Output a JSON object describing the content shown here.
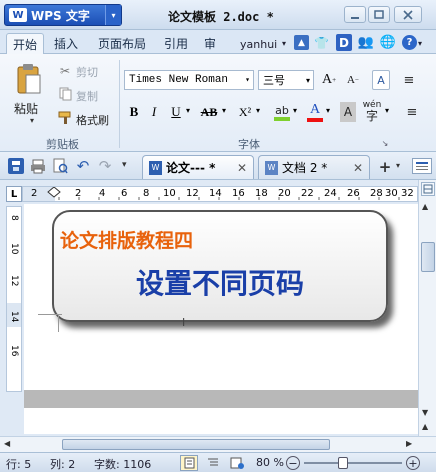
{
  "app": {
    "name": "WPS 文字",
    "logo": "W",
    "menu_arrow": "▾"
  },
  "window": {
    "title": "论文模板 2.doc *"
  },
  "ribbon_tabs": [
    "开始",
    "插入",
    "页面布局",
    "引用",
    "审"
  ],
  "user": "yanhui",
  "clipboard": {
    "paste": "粘贴",
    "cut": "剪切",
    "copy": "复制",
    "format_painter": "格式刷",
    "group_label": "剪贴板"
  },
  "font": {
    "name": "Times New Roman",
    "size": "三号",
    "group_label": "字体",
    "bold": "B",
    "italic": "I",
    "underline": "U",
    "strike": "AB",
    "superscript": "X²",
    "grow": "A",
    "clear": "A",
    "pinyin": "wén",
    "pinyin_char": "字",
    "font_color": "A",
    "highlight": "ab",
    "char_shading": "A"
  },
  "doc_tabs": [
    {
      "label": "论文--- *"
    },
    {
      "label": "文档 2 *"
    }
  ],
  "ruler_ticks": [
    "2",
    "2",
    "4",
    "6",
    "8",
    "10",
    "12",
    "14",
    "16",
    "18",
    "20",
    "22",
    "24",
    "26",
    "28",
    "30",
    "32"
  ],
  "vruler_ticks": [
    "8",
    "10",
    "12",
    "14",
    "16"
  ],
  "banner": {
    "subtitle": "论文排版教程四",
    "title": "设置不同页码",
    "subtitle_color": "#e8620c",
    "title_color": "#1a3fa8"
  },
  "status": {
    "line": "行: 5",
    "col": "列: 2",
    "words": "字数: 1106",
    "zoom": "80 %"
  }
}
